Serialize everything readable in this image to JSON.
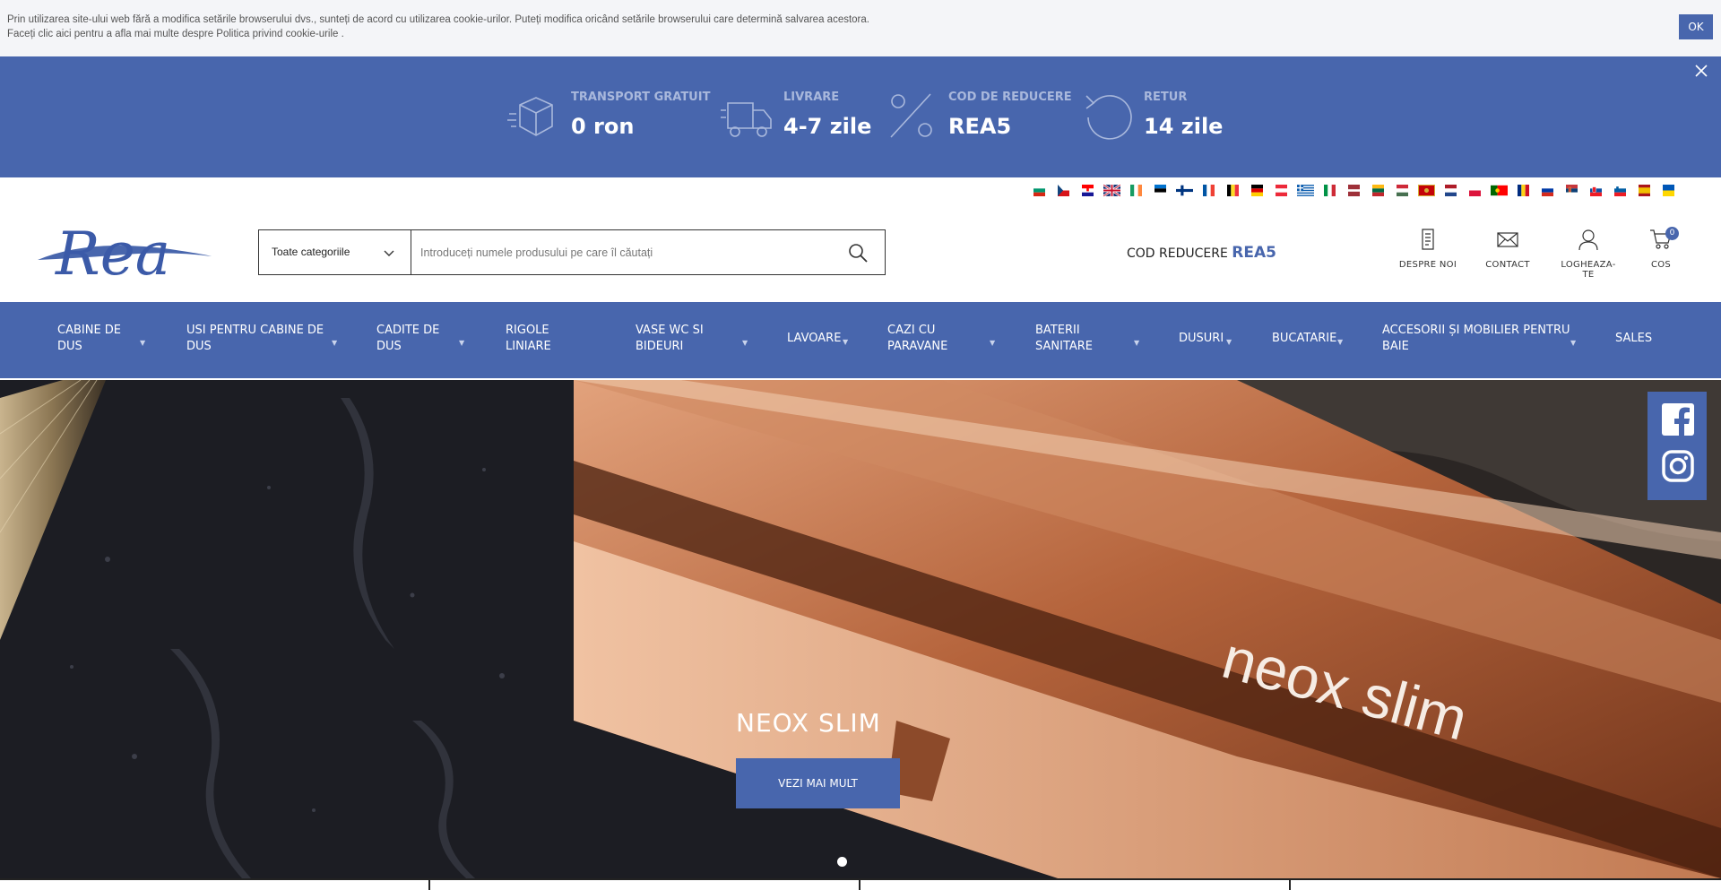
{
  "cookie": {
    "line1": "Prin utilizarea site-ului web fără a modifica setările browserului dvs., sunteți de acord cu utilizarea cookie-urilor. Puteți modifica oricând setările browserului care determină salvarea acestora.",
    "line2": "Faceți clic aici pentru a afla mai multe despre Politica privind cookie-urile .",
    "ok_label": "OK"
  },
  "promo": {
    "close_icon": "close-icon",
    "benefits": [
      {
        "title": "TRANSPORT GRATUIT",
        "value": "0 ron",
        "icon": "box-icon"
      },
      {
        "title": "LIVRARE",
        "value": "4-7 zile",
        "icon": "truck-icon"
      },
      {
        "title": "COD DE REDUCERE",
        "value": "REA5",
        "icon": "percent-icon"
      },
      {
        "title": "RETUR",
        "value": "14 zile",
        "icon": "return-icon"
      }
    ]
  },
  "header": {
    "flags": [
      "bulgaria",
      "czech-republic",
      "croatia",
      "united-kingdom",
      "ireland",
      "estonia",
      "finland",
      "france",
      "belgium",
      "germany",
      "austria",
      "greece",
      "italy",
      "latvia",
      "lithuania",
      "hungary",
      "montenegro",
      "netherlands",
      "poland",
      "portugal",
      "romania",
      "russia",
      "serbia",
      "slovakia",
      "slovenia",
      "spain",
      "ukraine"
    ],
    "logo_text": "Rea",
    "search": {
      "category": "Toate categoriile",
      "placeholder": "Introduceți numele produsului pe care îl căutați"
    },
    "promo_code_label": "COD REDUCERE",
    "promo_code_value": "REA5",
    "icons": {
      "about": "DESPRE NOI",
      "contact": "CONTACT",
      "login": "LOGHEAZA-TE",
      "cart": "COS",
      "cart_count": "0"
    }
  },
  "nav": {
    "items": [
      {
        "line1": "CABINE DE",
        "line2": "DUS"
      },
      {
        "line1": "USI PENTRU CABINE DE",
        "line2": "DUS"
      },
      {
        "line1": "CADITE DE",
        "line2": "DUS"
      },
      {
        "line1": "RIGOLE",
        "line2": "LINIARE"
      },
      {
        "line1": "VASE WC SI",
        "line2": "BIDEURI"
      },
      {
        "line1": "LAVOARE",
        "line2": ""
      },
      {
        "line1": "CAZI CU",
        "line2": "PARAVANE"
      },
      {
        "line1": "BATERII",
        "line2": "SANITARE"
      },
      {
        "line1": "DUSURI",
        "line2": ""
      },
      {
        "line1": "BUCATARIE",
        "line2": ""
      },
      {
        "line1": "ACCESORII ȘI MOBILIER PENTRU",
        "line2": "BAIE"
      },
      {
        "line1": "SALES",
        "line2": ""
      }
    ]
  },
  "hero": {
    "title": "NEOX SLIM",
    "button_label": "VEZI MAI MULT",
    "image_text": "neox slim",
    "active_slide": 1
  },
  "social": [
    "facebook-icon",
    "instagram-icon"
  ]
}
